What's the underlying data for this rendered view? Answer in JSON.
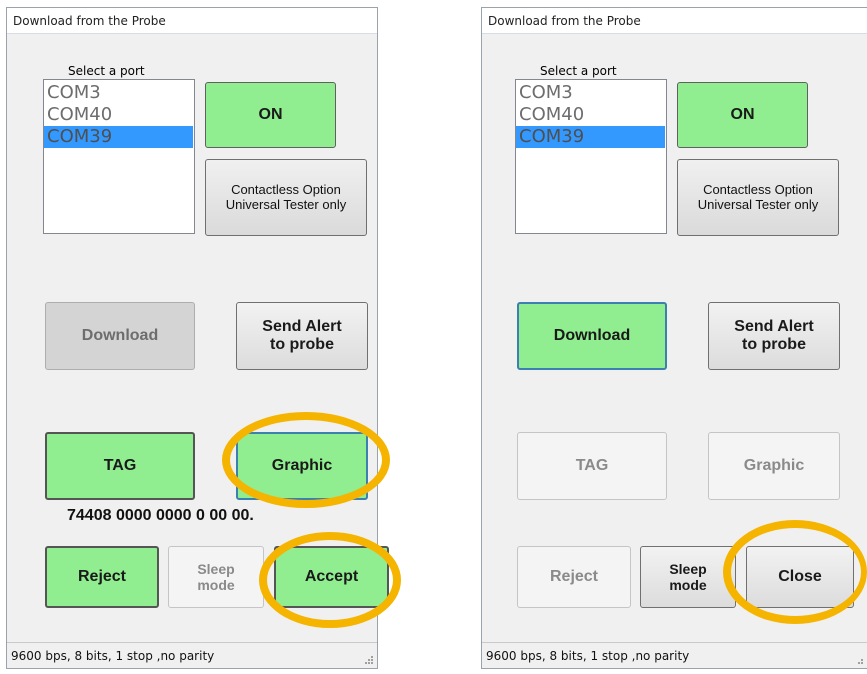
{
  "windows": [
    {
      "title": "Download from the  Probe",
      "port_caption": "Select a port",
      "ports": [
        "COM3",
        "COM40",
        "COM39"
      ],
      "selected_port": "COM39",
      "on_button": "ON",
      "contactless_button": "Contactless Option\nUniversal Tester only",
      "download_button": "Download",
      "send_alert_button": "Send Alert\nto probe",
      "tag_button": "TAG",
      "graphic_button": "Graphic",
      "tag_number": "74408 0000 0000 0 00 00.",
      "reject_button": "Reject",
      "sleep_button": "Sleep\nmode",
      "accept_button": "Accept",
      "status": "9600 bps, 8 bits, 1 stop ,no parity"
    },
    {
      "title": "Download from the  Probe",
      "port_caption": "Select a port",
      "ports": [
        "COM3",
        "COM40",
        "COM39"
      ],
      "selected_port": "COM39",
      "on_button": "ON",
      "contactless_button": "Contactless Option\nUniversal Tester only",
      "download_button": "Download",
      "send_alert_button": "Send Alert\nto probe",
      "tag_button": "TAG",
      "graphic_button": "Graphic",
      "reject_button": "Reject",
      "sleep_button": "Sleep\nmode",
      "close_button": "Close",
      "status": "9600 bps, 8 bits, 1 stop ,no parity"
    }
  ],
  "colors": {
    "active_button": "#90ee90",
    "selection": "#3399ff",
    "highlight_ring": "#f5b400"
  }
}
